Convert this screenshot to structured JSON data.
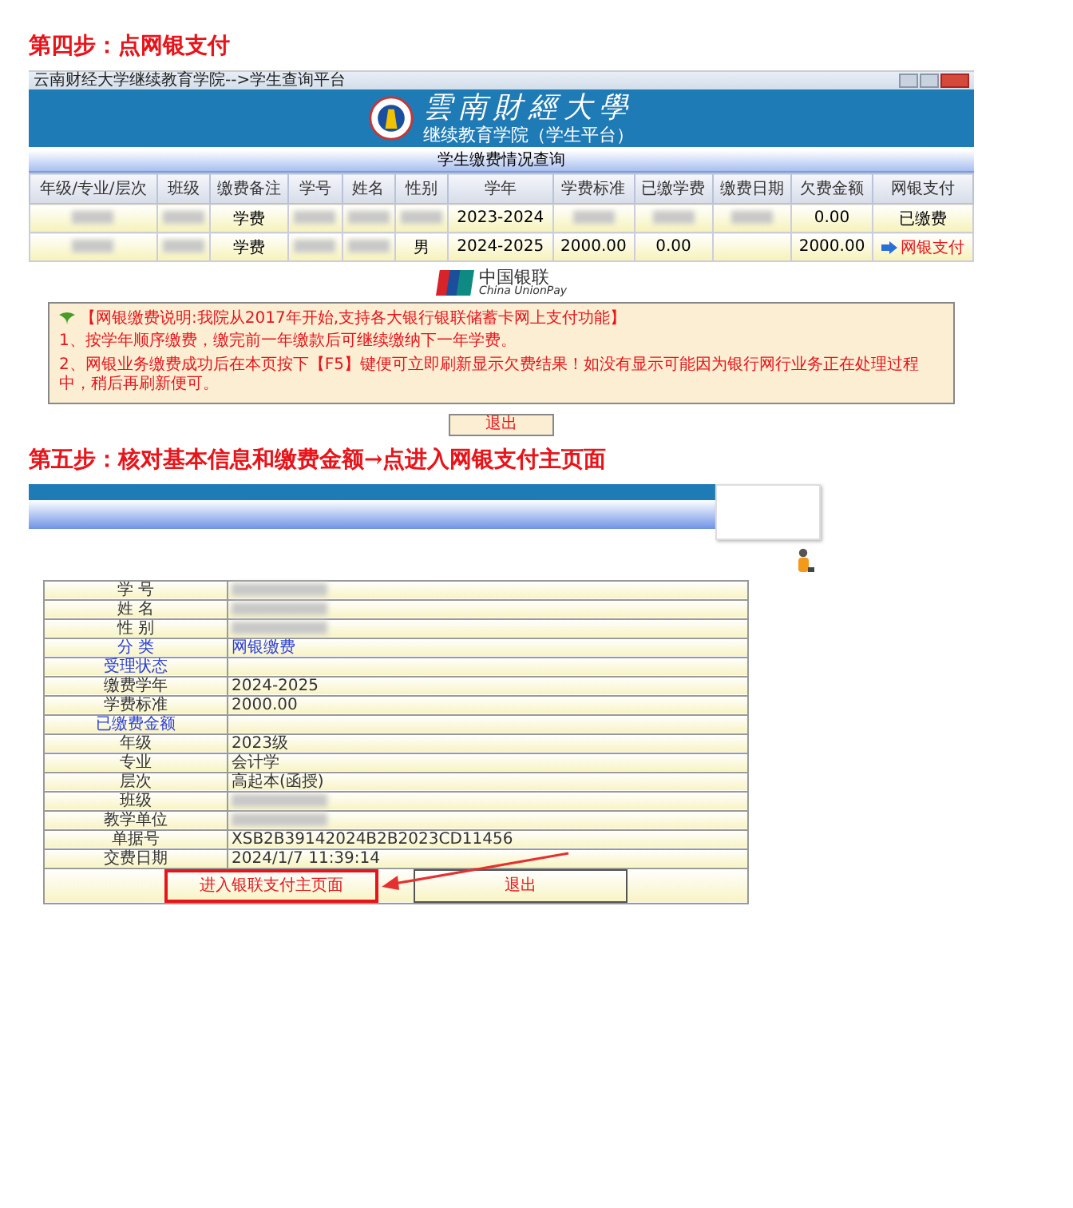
{
  "steps": [
    {
      "title": "第四步：点网银支付",
      "kind": "list_screen",
      "window_title": "云南财经大学继续教育学院-->学生查询平台",
      "banner": {
        "title": "雲南財經大學",
        "subtitle": "继续教育学院（学生平台）"
      },
      "section_title": "学生缴费情况查询",
      "columns": [
        "年级/专业/层次",
        "班级",
        "缴费备注",
        "学号",
        "姓名",
        "性别",
        "学年",
        "学费标准",
        "已缴学费",
        "缴费日期",
        "欠费金额",
        "网银支付"
      ],
      "rows": [
        {
          "cells": [
            {
              "kind": "redacted"
            },
            {
              "kind": "redacted"
            },
            {
              "kind": "text",
              "text": "学费"
            },
            {
              "kind": "redacted"
            },
            {
              "kind": "redacted"
            },
            {
              "kind": "redacted"
            },
            {
              "kind": "text",
              "text": "2023-2024"
            },
            {
              "kind": "redacted"
            },
            {
              "kind": "redacted"
            },
            {
              "kind": "redacted"
            },
            {
              "kind": "text",
              "text": "0.00"
            },
            {
              "kind": "text",
              "text": "已缴费"
            }
          ]
        },
        {
          "cells": [
            {
              "kind": "redacted"
            },
            {
              "kind": "redacted"
            },
            {
              "kind": "text",
              "text": "学费"
            },
            {
              "kind": "redacted"
            },
            {
              "kind": "redacted"
            },
            {
              "kind": "text",
              "text": "男"
            },
            {
              "kind": "text",
              "text": "2024-2025"
            },
            {
              "kind": "text",
              "text": "2000.00"
            },
            {
              "kind": "text",
              "text": "0.00"
            },
            {
              "kind": "empty"
            },
            {
              "kind": "text",
              "text": "2000.00"
            },
            {
              "kind": "pay_link",
              "text": "网银支付"
            }
          ]
        }
      ],
      "unionpay": {
        "name": "中国银联",
        "english": "China UnionPay"
      },
      "notice": {
        "heading": "【网银缴费说明:我院从2017年开始,支持各大银行银联储蓄卡网上支付功能】",
        "lines": [
          "1、按学年顺序缴费，缴完前一年缴款后可继续缴纳下一年学费。",
          "2、网银业务缴费成功后在本页按下【F5】键便可立即刷新显示欠费结果！如没有显示可能因为银行网行业务正在处理过程中，稍后再刷新便可。"
        ]
      },
      "exit_button": "退出"
    },
    {
      "title": "第五步：核对基本信息和缴费金额→点进入网银支付主页面",
      "kind": "detail_screen",
      "fields": [
        {
          "label": "学 号",
          "blue": false,
          "redacted": true
        },
        {
          "label": "姓 名",
          "blue": false,
          "redacted": true
        },
        {
          "label": "性 别",
          "blue": false,
          "redacted": true
        },
        {
          "label": "分 类",
          "blue": true,
          "value": "网银缴费",
          "redacted": false
        },
        {
          "label": "受理状态",
          "blue": true,
          "redacted": false
        },
        {
          "label": "缴费学年",
          "blue": false,
          "value": "2024-2025",
          "redacted": false
        },
        {
          "label": "学费标准",
          "blue": false,
          "value": "2000.00",
          "redacted": false
        },
        {
          "label": "已缴费金额",
          "blue": true,
          "redacted": false
        },
        {
          "label": "年级",
          "blue": false,
          "value": "2023级",
          "redacted": false
        },
        {
          "label": "专业",
          "blue": false,
          "value": "会计学",
          "redacted": false
        },
        {
          "label": "层次",
          "blue": false,
          "value": "高起本(函授)",
          "redacted": false
        },
        {
          "label": "班级",
          "blue": false,
          "redacted": true
        },
        {
          "label": "教学单位",
          "blue": false,
          "redacted": true
        },
        {
          "label": "单据号",
          "blue": false,
          "value": "XSB2B39142024B2B2023CD11456",
          "redacted": false
        },
        {
          "label": "交费日期",
          "blue": false,
          "value": "2024/1/7 11:39:14",
          "redacted": false
        }
      ],
      "buttons": [
        {
          "label": "进入银联支付主页面",
          "highlighted": true
        },
        {
          "label": "退出",
          "highlighted": false
        }
      ]
    }
  ]
}
